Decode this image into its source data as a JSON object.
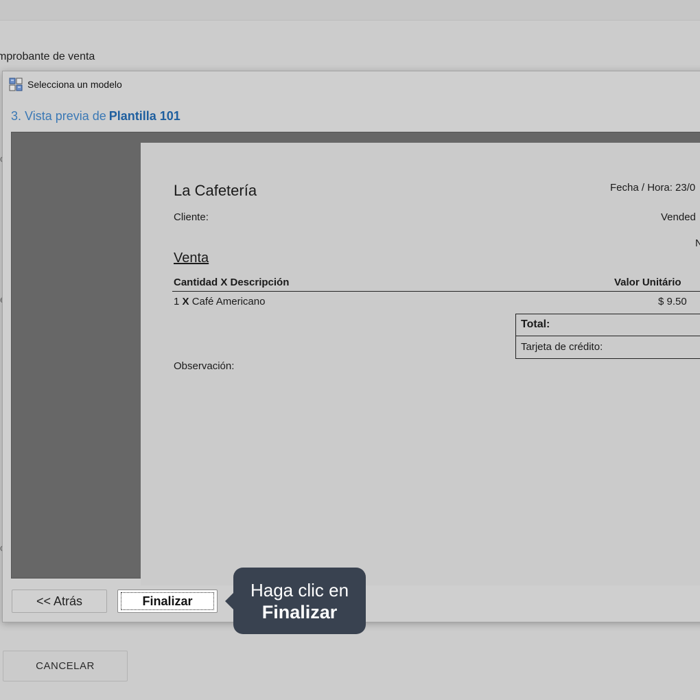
{
  "background": {
    "page_title": "mprobante de venta",
    "cancel_label": "CANCELAR",
    "edge_fragments": [
      "o",
      "o",
      "e",
      "o"
    ]
  },
  "dialog": {
    "title": "Selecciona un modelo",
    "icon": "template-icon",
    "step_label": "3. Vista previa de",
    "template_name": "Plantilla 101"
  },
  "receipt": {
    "store_name": "La Cafetería",
    "datetime_label": "Fecha / Hora: 23/0",
    "client_label": "Cliente:",
    "seller_label": "Vended",
    "n_label": "N",
    "section_title": "Venta",
    "col_qty_desc": "Cantidad X Descripción",
    "col_unit_value": "Valor Unitário",
    "items": [
      {
        "qty": "1",
        "x": "X",
        "description": "Café Americano",
        "unit_price": "$ 9.50"
      }
    ],
    "total_label": "Total:",
    "payment_label": "Tarjeta de crédito:",
    "observation_label": "Observación:"
  },
  "footer": {
    "back_label": "<< Atrás",
    "finish_label": "Finalizar"
  },
  "tooltip": {
    "line1": "Haga clic en",
    "line2": "Finalizar",
    "bg_color": "#394250"
  }
}
